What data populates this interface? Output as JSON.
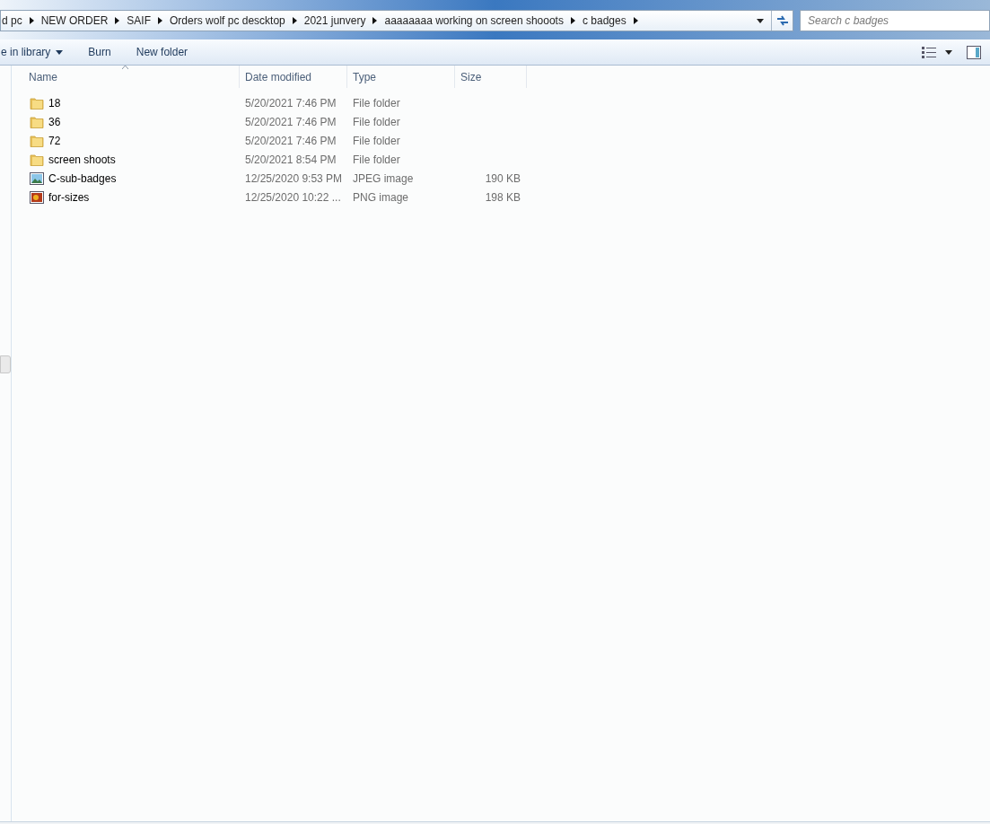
{
  "address_bar": {
    "crumbs": [
      "d pc",
      "NEW ORDER",
      "SAIF",
      "Orders wolf pc descktop",
      "2021 junvery",
      "aaaaaaaa working on screen shooots",
      "c badges"
    ]
  },
  "search": {
    "placeholder": "Search c badges"
  },
  "toolbar": {
    "items": [
      {
        "label": "e in library",
        "kind": "menu"
      },
      {
        "label": "Burn",
        "kind": "plain"
      },
      {
        "label": "New folder",
        "kind": "plain"
      }
    ]
  },
  "table": {
    "columns": [
      "Name",
      "Date modified",
      "Type",
      "Size"
    ],
    "rows": [
      {
        "kind": "folder",
        "name": "18",
        "date": "5/20/2021 7:46 PM",
        "type": "File folder"
      },
      {
        "kind": "folder",
        "name": "36",
        "date": "5/20/2021 7:46 PM",
        "type": "File folder"
      },
      {
        "kind": "folder",
        "name": "72",
        "date": "5/20/2021 7:46 PM",
        "type": "File folder"
      },
      {
        "kind": "folder",
        "name": "screen shoots",
        "date": "5/20/2021 8:54 PM",
        "type": "File folder"
      },
      {
        "kind": "jpeg",
        "name": "C-sub-badges",
        "date": "12/25/2020 9:53 PM",
        "type": "JPEG image",
        "size": "190 KB"
      },
      {
        "kind": "png",
        "name": "for-sizes",
        "date": "12/25/2020 10:22 ...",
        "type": "PNG image",
        "size": "198 KB"
      }
    ]
  }
}
